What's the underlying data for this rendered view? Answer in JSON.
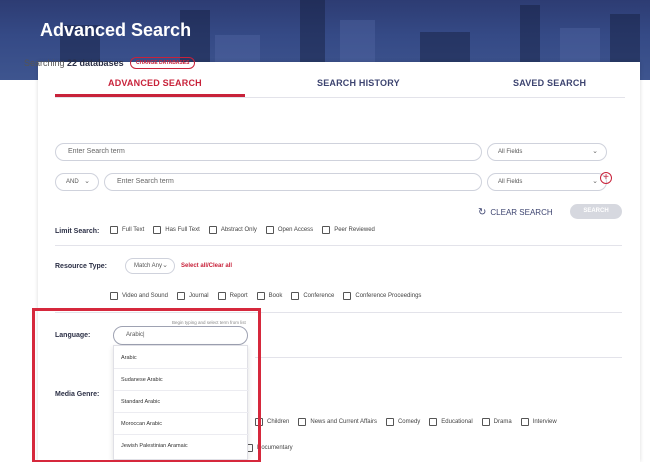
{
  "hero": {
    "title": "Advanced Search"
  },
  "tabs": [
    {
      "label": "ADVANCED SEARCH",
      "active": true
    },
    {
      "label": "SEARCH HISTORY",
      "active": false
    },
    {
      "label": "SAVED SEARCH",
      "active": false
    }
  ],
  "searching": {
    "prefix": "Searching",
    "count_text": "22 databases",
    "change_label": "CHANGE DATABASES"
  },
  "search_rows": [
    {
      "placeholder": "Enter Search term",
      "field": "All Fields"
    },
    {
      "operator": "AND",
      "placeholder": "Enter Search term",
      "field": "All Fields"
    }
  ],
  "actions": {
    "clear_label": "CLEAR SEARCH",
    "search_label": "SEARCH"
  },
  "limit_search": {
    "label": "Limit Search:",
    "options": [
      "Full Text",
      "Has Full Text",
      "Abstract Only",
      "Open Access",
      "Peer Reviewed"
    ]
  },
  "resource_type": {
    "label": "Resource Type:",
    "match": "Match Any",
    "select_all": "Select all/Clear all",
    "options": [
      "Video and Sound",
      "Journal",
      "Report",
      "Book",
      "Conference",
      "Conference Proceedings"
    ]
  },
  "language": {
    "label": "Language:",
    "hint": "Begin typing and select term from list",
    "value": "Arabic|",
    "suggestions": [
      "Arabic",
      "Sudanese Arabic",
      "Standard Arabic",
      "Moroccan Arabic",
      "Jewish Palestinian Aramaic"
    ]
  },
  "media_genre": {
    "label": "Media Genre:",
    "options": [
      "Children",
      "News and Current Affairs",
      "Comedy",
      "Educational",
      "Drama",
      "Interview"
    ],
    "options_row2": [
      "Documentary"
    ]
  },
  "colors": {
    "accent": "#c8223a",
    "nav": "#3d4470",
    "hero": "#354a86"
  }
}
